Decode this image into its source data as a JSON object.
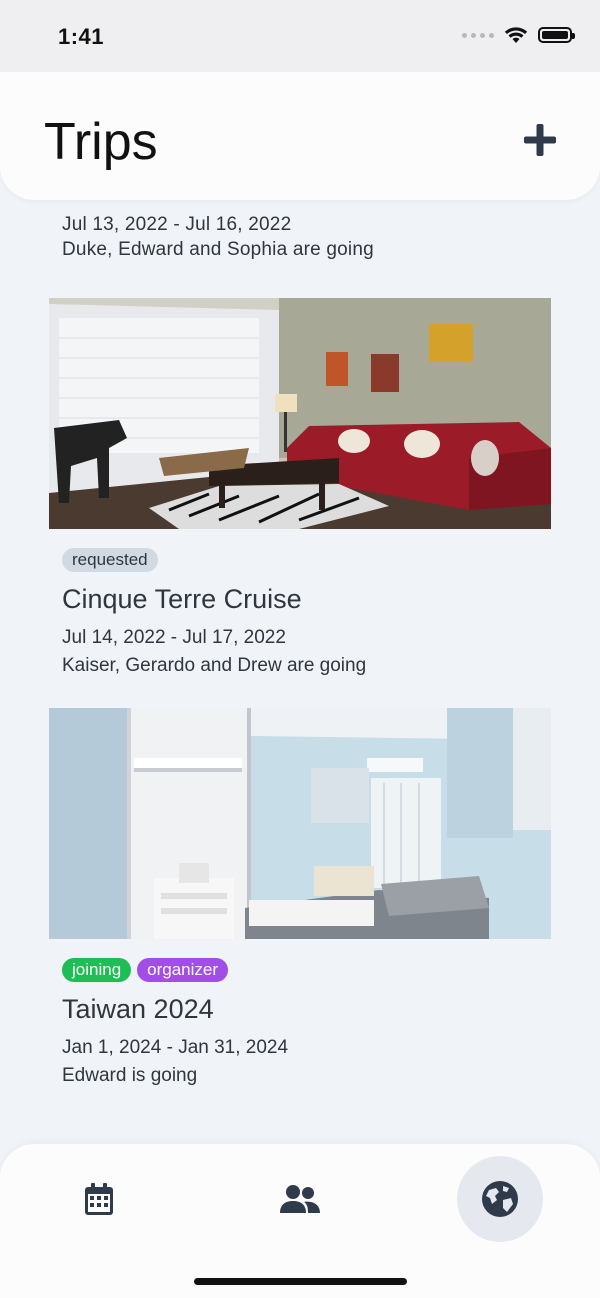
{
  "status_bar": {
    "time": "1:41"
  },
  "header": {
    "title": "Trips",
    "add_icon": "plus-icon"
  },
  "partial_trip": {
    "dates": "Jul 13, 2022 - Jul 16, 2022",
    "going": "Duke, Edward and Sophia are going"
  },
  "trips": [
    {
      "badges": [
        "requested"
      ],
      "name": "Cinque Terre Cruise",
      "dates": "Jul 14, 2022 - Jul 17, 2022",
      "going": "Kaiser, Gerardo and Drew are going"
    },
    {
      "badges": [
        "joining",
        "organizer"
      ],
      "name": "Taiwan 2024",
      "dates": "Jan 1, 2024 - Jan 31, 2024",
      "going": "Edward is going"
    }
  ],
  "bottom_nav": {
    "items": [
      {
        "icon": "calendar-icon",
        "active": false
      },
      {
        "icon": "users-icon",
        "active": false
      },
      {
        "icon": "globe-icon",
        "active": true
      }
    ]
  },
  "colors": {
    "badge_requested": "#d1d9e3",
    "badge_joining": "#1fbe55",
    "badge_organizer": "#a24ee6",
    "background": "#f0f3f7"
  }
}
